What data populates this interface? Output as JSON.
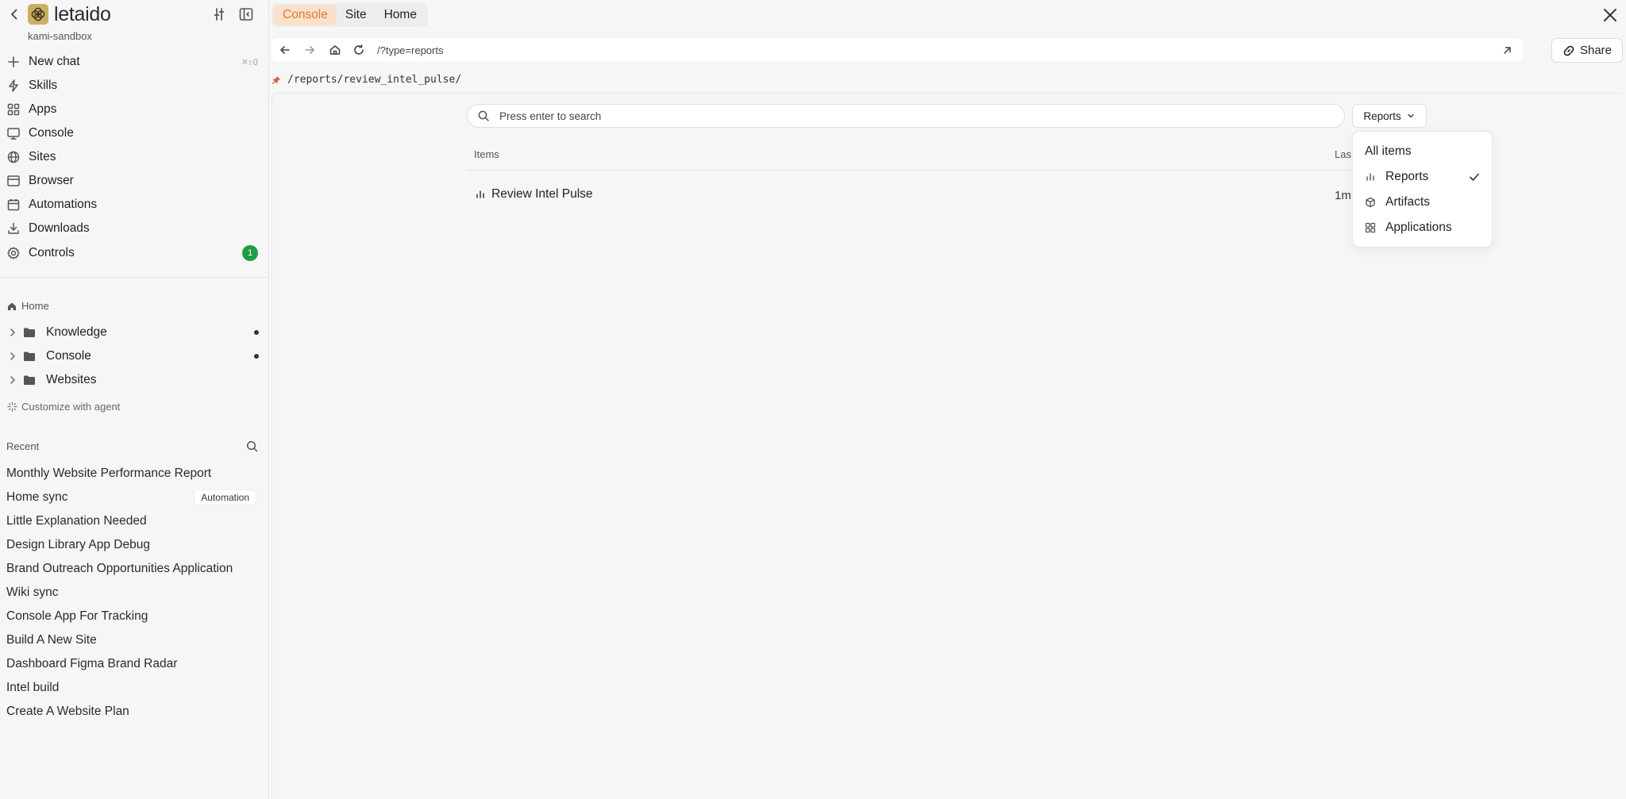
{
  "brand": {
    "name": "letaido",
    "workspace": "kami-sandbox"
  },
  "nav": [
    {
      "id": "new-chat",
      "label": "New chat",
      "icon": "plus-icon",
      "shortcut": "⌘⇧O"
    },
    {
      "id": "skills",
      "label": "Skills",
      "icon": "bolt-icon"
    },
    {
      "id": "apps",
      "label": "Apps",
      "icon": "grid-icon"
    },
    {
      "id": "console",
      "label": "Console",
      "icon": "monitor-icon"
    },
    {
      "id": "sites",
      "label": "Sites",
      "icon": "globe-icon"
    },
    {
      "id": "browser",
      "label": "Browser",
      "icon": "browser-icon"
    },
    {
      "id": "automations",
      "label": "Automations",
      "icon": "calendar-icon"
    },
    {
      "id": "downloads",
      "label": "Downloads",
      "icon": "download-icon"
    },
    {
      "id": "controls",
      "label": "Controls",
      "icon": "gear-icon",
      "badge": "1"
    }
  ],
  "home": {
    "label": "Home",
    "folders": [
      {
        "label": "Knowledge",
        "dot": true
      },
      {
        "label": "Console",
        "dot": true
      },
      {
        "label": "Websites",
        "dot": false
      }
    ],
    "customize": "Customize with agent"
  },
  "recent": {
    "label": "Recent",
    "items": [
      {
        "label": "Monthly Website Performance Report"
      },
      {
        "label": "Home sync",
        "tag": "Automation"
      },
      {
        "label": "Little Explanation Needed"
      },
      {
        "label": "Design Library App Debug"
      },
      {
        "label": "Brand Outreach Opportunities Application"
      },
      {
        "label": "Wiki sync"
      },
      {
        "label": "Console App For Tracking"
      },
      {
        "label": "Build A New Site"
      },
      {
        "label": "Dashboard Figma Brand Radar"
      },
      {
        "label": "Intel build"
      },
      {
        "label": "Create A Website Plan"
      }
    ]
  },
  "tabs": [
    {
      "label": "Console",
      "active": true
    },
    {
      "label": "Site",
      "active": false
    },
    {
      "label": "Home",
      "active": false
    }
  ],
  "urlbar": {
    "url": "/?type=reports"
  },
  "share": {
    "label": "Share"
  },
  "pinned_path": "/reports/review_intel_pulse/",
  "search": {
    "placeholder": "Press enter to search"
  },
  "filter": {
    "label": "Reports"
  },
  "table": {
    "columns": [
      "Items",
      "Las"
    ],
    "rows": [
      {
        "title": "Review Intel Pulse",
        "time": "1m"
      }
    ]
  },
  "dropdown": {
    "items": [
      {
        "label": "All items",
        "icon": null,
        "checked": false
      },
      {
        "label": "Reports",
        "icon": "bar-chart-icon",
        "checked": true
      },
      {
        "label": "Artifacts",
        "icon": "cube-icon",
        "checked": false
      },
      {
        "label": "Applications",
        "icon": "grid-icon",
        "checked": false
      }
    ]
  },
  "colors": {
    "accent_tab_bg": "#fbe1cc",
    "accent_tab_text": "#e27a2c",
    "badge_green": "#1f9d45",
    "logo": "#c9b060"
  }
}
